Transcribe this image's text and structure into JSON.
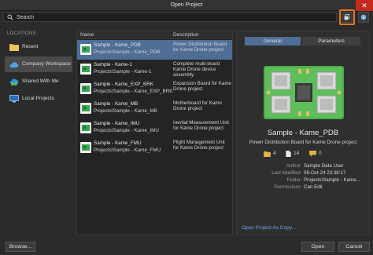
{
  "window": {
    "title": "Open Project",
    "close_glyph": "✕"
  },
  "search": {
    "placeholder": "Search"
  },
  "toolbar": {
    "icons": [
      "copy-icon",
      "info-icon"
    ]
  },
  "locations": {
    "heading": "LOCATIONS",
    "items": [
      {
        "label": "Recent",
        "icon": "folder-icon",
        "active": false
      },
      {
        "label": "Company Workspace",
        "icon": "cloud-icon",
        "active": true
      },
      {
        "label": "Shared With Me",
        "icon": "shared-icon",
        "active": false
      },
      {
        "label": "Local Projects",
        "icon": "monitor-icon",
        "active": false
      }
    ]
  },
  "list": {
    "columns": [
      "Name",
      "Description"
    ],
    "rows": [
      {
        "name": "Sample - Kame_PDB",
        "path": "Projects\\Sample - Kame_PDB",
        "description": "Power Distribution Board for Kame Drone project",
        "selected": true
      },
      {
        "name": "Sample - Kame-1",
        "path": "Projects\\Sample - Kame-1",
        "description": "Complete multi-board Kame Drone device assembly.",
        "selected": false
      },
      {
        "name": "Sample - Kame_EXP_BRK",
        "path": "Projects\\Sample - Kame_EXP_BRK",
        "description": "Expansion Board for Kame Drone project",
        "selected": false
      },
      {
        "name": "Sample - Kame_MB",
        "path": "Projects\\Sample - Kame_MB",
        "description": "Motherboard for Kame Drone project",
        "selected": false
      },
      {
        "name": "Sample - Kame_IMU",
        "path": "Projects\\Sample - Kame_IMU",
        "description": "Inertial Measurement Unit for Kame Drone project",
        "selected": false
      },
      {
        "name": "Sample - Kame_FMU",
        "path": "Projects\\Sample - Kame_FMU",
        "description": "Flight Management Unit for Kame Drone project",
        "selected": false
      }
    ]
  },
  "details": {
    "tabs": [
      {
        "label": "General",
        "active": true
      },
      {
        "label": "Parameters",
        "active": false
      }
    ],
    "name": "Sample - Kame_PDB",
    "description": "Power Distribution Board for Kame Drone project",
    "stats": {
      "folders": "4",
      "documents": "14",
      "comments": "0"
    },
    "meta": [
      {
        "key": "Author",
        "value": "Sample Data User"
      },
      {
        "key": "Last Modified",
        "value": "08-Oct-24 23:38:17"
      },
      {
        "key": "Folder",
        "value": "Projects\\Sample - Kame..."
      },
      {
        "key": "Permissions",
        "value": "Can Edit"
      }
    ],
    "open_as_copy": "Open Project As Copy..."
  },
  "footer": {
    "browse_label": "Browse...",
    "open_label": "Open",
    "cancel_label": "Cancel"
  },
  "colors": {
    "accent": "#4e6e96",
    "highlight": "#e07a1b",
    "link": "#6fa8e6",
    "close": "#c42b1c"
  }
}
